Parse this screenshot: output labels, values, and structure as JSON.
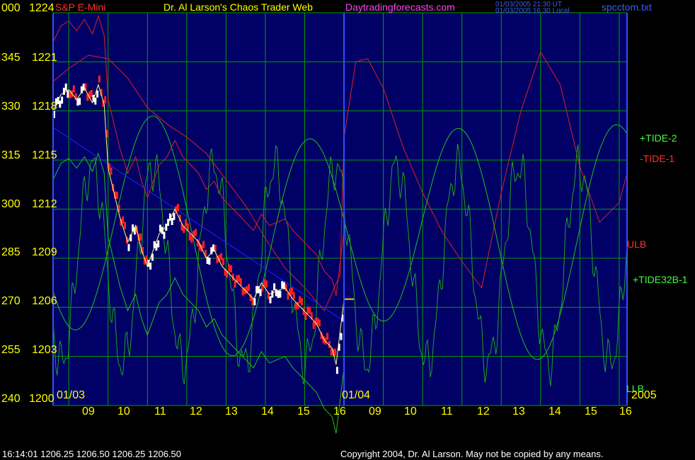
{
  "colors": {
    "background": "#000066",
    "grid": "#00a000",
    "axis": "#3050ff",
    "price_up": "#ffffff",
    "price_down": "#ff2020",
    "moving_avg": "#ffff80",
    "blue_line": "#2020ff",
    "tide1": "#dd2020",
    "tide2": "#20c020",
    "tide32b": "#20a020",
    "label_yellow": "#ffff00",
    "label_magenta": "#ff40ff",
    "label_red": "#ff3030",
    "label_green": "#40ff40"
  },
  "header": {
    "instrument": "S&P E-Mini",
    "title": "Dr. Al Larson's Chaos Trader Web",
    "site": "Daytradingforecasts.com",
    "timestamp_line1": "01/03/2005 21:30 UT",
    "timestamp_line2": "01/03/2005 16:30 Local",
    "filename": "spcctom.txt"
  },
  "footer": {
    "quote": "16:14:01  1206.25 1206.50 1206.25 1206.50",
    "copyright": "Copyright 2004, Dr. Al Larson. May not be copied by any means."
  },
  "chart_data": {
    "type": "line",
    "title": "S&P E-Mini",
    "y_axis": {
      "angle_ticks": [
        "000",
        "345",
        "330",
        "315",
        "300",
        "285",
        "270",
        "255",
        "240"
      ],
      "price_ticks": [
        "1224",
        "1221",
        "1218",
        "1215",
        "1212",
        "1209",
        "1206",
        "1203",
        "1200"
      ],
      "price_range": [
        1200,
        1224
      ]
    },
    "x_axis": {
      "hour_ticks": [
        "09",
        "10",
        "11",
        "12",
        "13",
        "14",
        "15",
        "16",
        "09",
        "10",
        "11",
        "12",
        "13",
        "14",
        "15",
        "16"
      ],
      "date_labels": [
        "01/03",
        "01/04",
        "2005"
      ]
    },
    "legend": [
      {
        "name": "+TIDE-2",
        "color": "#40ff40"
      },
      {
        "name": "-TIDE-1",
        "color": "#ff3030"
      },
      {
        "name": "ULB",
        "color": "#ff3030"
      },
      {
        "name": "+TIDE32B-1",
        "color": "#40ff40"
      },
      {
        "name": "LLB",
        "color": "#40ff40"
      }
    ],
    "last_price": 1206.5,
    "price_series": {
      "name": "S&P E-Mini",
      "x_hours": [
        8.6,
        8.8,
        9.0,
        9.2,
        9.4,
        9.6,
        9.75,
        9.9,
        10.0,
        10.15,
        10.3,
        10.5,
        10.7,
        10.85,
        11.0,
        11.15,
        11.3,
        11.5,
        11.7,
        11.9,
        12.1,
        12.3,
        12.5,
        12.7,
        12.9,
        13.1,
        13.3,
        13.5,
        13.7,
        13.9,
        14.1,
        14.3,
        14.5,
        14.7,
        14.9,
        15.1,
        15.3,
        15.5,
        15.7,
        15.8,
        15.9,
        16.0
      ],
      "values": [
        1218.0,
        1219.0,
        1219.3,
        1218.7,
        1219.4,
        1218.5,
        1219.6,
        1218.4,
        1214.5,
        1213.0,
        1211.5,
        1210.0,
        1211.0,
        1209.5,
        1208.5,
        1209.5,
        1210.5,
        1211.0,
        1212.0,
        1211.0,
        1210.5,
        1210.0,
        1209.0,
        1209.5,
        1208.5,
        1208.0,
        1207.5,
        1207.0,
        1206.5,
        1207.5,
        1206.8,
        1207.0,
        1207.2,
        1206.5,
        1206.0,
        1205.5,
        1205.0,
        1204.0,
        1203.5,
        1202.5,
        1204.5,
        1206.5
      ]
    },
    "tide_minus_1": {
      "name": "-TIDE-1",
      "x_hours": [
        8.6,
        9.0,
        9.5,
        10.0,
        10.5,
        11.0,
        11.5,
        12.0,
        12.5,
        13.0,
        13.5,
        14.0,
        14.5,
        15.0,
        15.5,
        15.9,
        16.0,
        16.3,
        16.6,
        17.0,
        17.5,
        18.0,
        18.5,
        19.0,
        19.5,
        20.0,
        20.5,
        21.0,
        21.5,
        22.0,
        22.5,
        23.0,
        23.2
      ],
      "angles": [
        339,
        343,
        347,
        346,
        340,
        331,
        326,
        322,
        317,
        309,
        301,
        291,
        282,
        276,
        269,
        280,
        322,
        345,
        346,
        337,
        319,
        305,
        293,
        284,
        276,
        305,
        330,
        348,
        338,
        313,
        296,
        302,
        311
      ]
    }
  }
}
